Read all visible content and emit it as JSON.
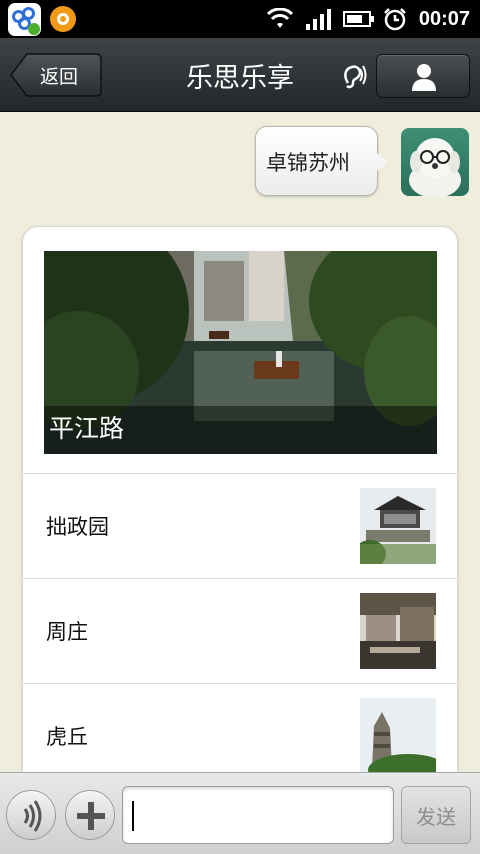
{
  "status_bar": {
    "time": "00:07",
    "icons": [
      "baidu-app-icon",
      "orange-app-icon",
      "wifi-icon",
      "signal-icon",
      "battery-icon",
      "alarm-icon"
    ]
  },
  "header": {
    "back_label": "返回",
    "title": "乐思乐享",
    "icons": [
      "ear-icon",
      "contact-icon"
    ]
  },
  "message": {
    "text": "卓锦苏州"
  },
  "card": {
    "hero_caption": "平江路",
    "items": [
      {
        "label": "拙政园"
      },
      {
        "label": "周庄"
      },
      {
        "label": "虎丘"
      }
    ]
  },
  "input_bar": {
    "value": "",
    "send_label": "发送"
  },
  "colors": {
    "header_dark": "#2b2f33",
    "chat_background": "#efeedd",
    "card_background": "#ffffff"
  }
}
